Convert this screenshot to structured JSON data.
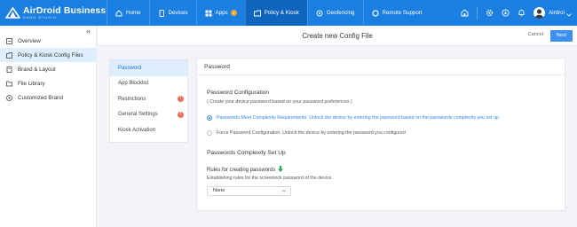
{
  "brand": {
    "name": "AirDroid Business",
    "subtitle": "SAND STUDIO"
  },
  "nav": {
    "items": [
      {
        "label": "Home",
        "icon": "home-icon"
      },
      {
        "label": "Devices",
        "icon": "devices-icon"
      },
      {
        "label": "Apps",
        "icon": "apps-icon",
        "badge": "1"
      },
      {
        "label": "Policy & Kiosk",
        "icon": "policy-icon",
        "active": true
      },
      {
        "label": "Geofencing",
        "icon": "geofencing-icon"
      },
      {
        "label": "Remote Support",
        "icon": "remote-support-icon"
      }
    ],
    "user_name": "Airdroi"
  },
  "sidebar": {
    "items": [
      {
        "label": "Overview",
        "icon": "overview-icon"
      },
      {
        "label": "Policy & Kiosk Config Files",
        "icon": "config-file-icon",
        "active": true
      },
      {
        "label": "Brand & Layout",
        "icon": "brand-icon"
      },
      {
        "label": "File Library",
        "icon": "folder-icon"
      },
      {
        "label": "Customized Brand",
        "icon": "customize-icon"
      }
    ]
  },
  "header": {
    "title": "Create new Config File",
    "cancel_label": "Cancel",
    "next_label": "Next"
  },
  "steps": [
    {
      "label": "Password",
      "active": true
    },
    {
      "label": "App Blocklist"
    },
    {
      "label": "Restrictions",
      "warning": "!"
    },
    {
      "label": "General Settings",
      "warning": "!"
    },
    {
      "label": "Kiosk Activation"
    }
  ],
  "content": {
    "heading": "Password",
    "config_title": "Password Configuration",
    "config_desc": "( Create your device password based on your password preferences )",
    "options": [
      {
        "label": "Passwords Meet Complexity Requirements: Unlock the device by entering the password based on the passwords complexity you set up",
        "checked": true
      },
      {
        "label": "Force Password Configuration: Unlock the device by entering the password you configured",
        "checked": false
      }
    ],
    "complexity_title": "Passwords Complexity Set Up",
    "rules_label": "Rules for creating passwords",
    "rules_desc": "Establishing rules for the screenlock password of the device.",
    "select_value": "None"
  },
  "colors": {
    "topbar": "#1a7fe0",
    "accent": "#2d85e8",
    "warning": "#ef6b5a",
    "badge": "#f3a526"
  }
}
